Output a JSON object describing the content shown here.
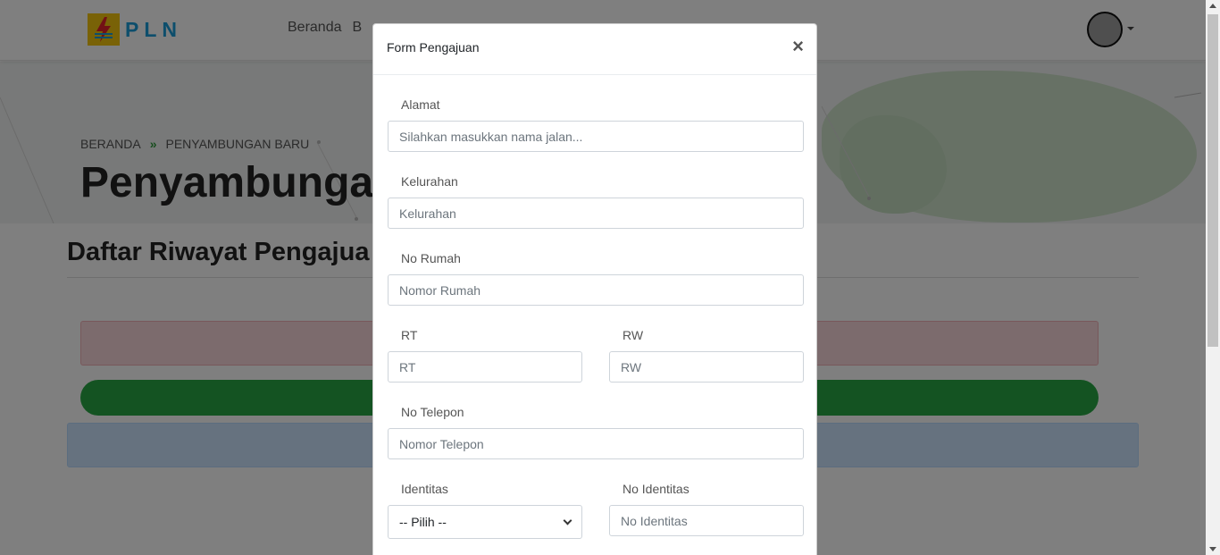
{
  "navbar": {
    "logo_text": "PLN",
    "links": [
      "Beranda",
      "B"
    ]
  },
  "hero": {
    "breadcrumb": [
      "BERANDA",
      "PENYAMBUNGAN BARU"
    ],
    "title": "Penyambunga"
  },
  "section": {
    "title": "Daftar Riwayat Pengajua"
  },
  "modal": {
    "title": "Form Pengajuan",
    "close": "×",
    "fields": {
      "alamat": {
        "label": "Alamat",
        "placeholder": "Silahkan masukkan nama jalan..."
      },
      "kelurahan": {
        "label": "Kelurahan",
        "placeholder": "Kelurahan"
      },
      "no_rumah": {
        "label": "No Rumah",
        "placeholder": "Nomor Rumah"
      },
      "rt": {
        "label": "RT",
        "placeholder": "RT"
      },
      "rw": {
        "label": "RW",
        "placeholder": "RW"
      },
      "no_telepon": {
        "label": "No Telepon",
        "placeholder": "Nomor Telepon"
      },
      "identitas": {
        "label": "Identitas",
        "selected": "-- Pilih --"
      },
      "no_identitas": {
        "label": "No Identitas",
        "placeholder": "No Identitas"
      }
    }
  },
  "colors": {
    "brand_blue": "#1a9dd9",
    "brand_yellow": "#f2c40f",
    "success_green": "#28a745",
    "danger_bg": "#f8d7da",
    "info_bg": "#cce5ff"
  }
}
